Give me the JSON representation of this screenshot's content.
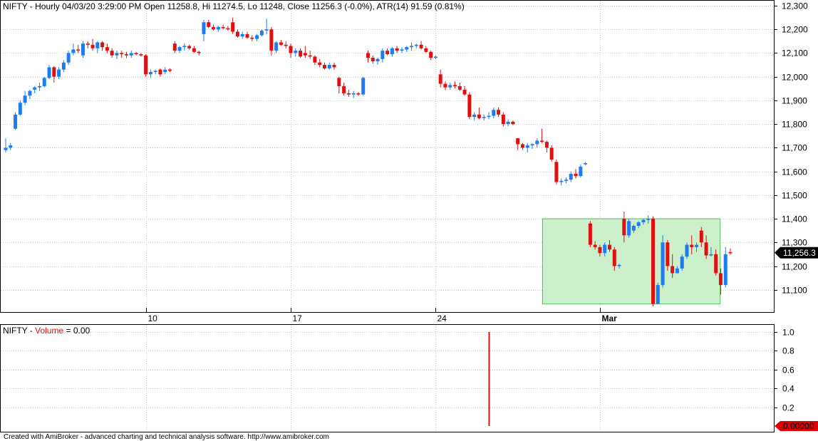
{
  "header": {
    "symbol": "NIFTY",
    "info": " - Hourly 04/03/20 3:29:00 PM Open 11258.8, Hi 11274.5, Lo 11248, Close 11256.3 (-0.0%), ATR(14) 91.59  (0.81%)"
  },
  "volume_header": {
    "symbol": "NIFTY",
    "dash": " - ",
    "label": "Volume",
    "value": " = 0.00"
  },
  "price_tag": "11,256.3",
  "volume_tag": "0.00000",
  "footer": "Created with AmiBroker - advanced charting and technical analysis software. http://www.amibroker.com",
  "colors": {
    "up": "#1e7cf0",
    "down": "#e01010",
    "grid": "#c8c8c8",
    "box_fill": "#ccf0cc",
    "box_stroke": "#55bb55",
    "tag": "#e00000"
  },
  "chart_data": {
    "type": "candlestick",
    "price_axis": {
      "ticks": [
        11100,
        11200,
        11300,
        11400,
        11500,
        11600,
        11700,
        11800,
        11900,
        12000,
        12100,
        12200,
        12300
      ],
      "tick_labels": [
        "11,100",
        "11,200",
        "11,300",
        "11,400",
        "11,500",
        "11,600",
        "11,700",
        "11,800",
        "11,900",
        "12,000",
        "12,100",
        "12,200",
        "12,300"
      ],
      "range": [
        11020,
        12310
      ]
    },
    "date_labels": [
      {
        "label": "10",
        "bar": 29
      },
      {
        "label": "17",
        "bar": 59
      },
      {
        "label": "24",
        "bar": 89
      },
      {
        "label": "Mar",
        "bar": 123,
        "bold": true
      }
    ],
    "highlight_box": {
      "bar_start": 112,
      "bar_end": 147,
      "price_low": 11040,
      "price_high": 11400
    },
    "candles": [
      [
        11690,
        11740,
        11680,
        11700
      ],
      [
        11700,
        11720,
        11690,
        11710
      ],
      [
        11780,
        11850,
        11775,
        11840
      ],
      [
        11840,
        11900,
        11835,
        11890
      ],
      [
        11890,
        11940,
        11880,
        11920
      ],
      [
        11920,
        11945,
        11905,
        11940
      ],
      [
        11945,
        11960,
        11930,
        11955
      ],
      [
        11955,
        11975,
        11940,
        11960
      ],
      [
        11960,
        12000,
        11955,
        11995
      ],
      [
        11995,
        12050,
        11990,
        12040
      ],
      [
        12040,
        12045,
        11975,
        12000
      ],
      [
        12000,
        12040,
        11990,
        12030
      ],
      [
        12030,
        12070,
        12020,
        12060
      ],
      [
        12060,
        12110,
        12050,
        12100
      ],
      [
        12100,
        12140,
        12090,
        12115
      ],
      [
        12115,
        12135,
        12100,
        12110
      ],
      [
        12090,
        12150,
        12080,
        12140
      ],
      [
        12140,
        12150,
        12120,
        12135
      ],
      [
        12135,
        12160,
        12110,
        12120
      ],
      [
        12120,
        12150,
        12100,
        12145
      ],
      [
        12145,
        12150,
        12110,
        12125
      ],
      [
        12125,
        12140,
        12100,
        12110
      ],
      [
        12110,
        12120,
        12080,
        12090
      ],
      [
        12090,
        12110,
        12075,
        12100
      ],
      [
        12100,
        12110,
        12080,
        12095
      ],
      [
        12095,
        12105,
        12080,
        12090
      ],
      [
        12090,
        12110,
        12080,
        12100
      ],
      [
        12100,
        12105,
        12090,
        12095
      ],
      [
        12095,
        12100,
        12085,
        12090
      ],
      [
        12090,
        12095,
        12000,
        12010
      ],
      [
        12010,
        12030,
        11995,
        12020
      ],
      [
        12020,
        12030,
        12010,
        12025
      ],
      [
        12030,
        12035,
        12000,
        12010
      ],
      [
        12020,
        12040,
        12010,
        12030
      ],
      [
        12030,
        12035,
        12020,
        12025
      ],
      [
        12140,
        12150,
        12100,
        12110
      ],
      [
        12110,
        12130,
        12100,
        12125
      ],
      [
        12125,
        12140,
        12110,
        12130
      ],
      [
        12130,
        12135,
        12115,
        12120
      ],
      [
        12120,
        12130,
        12100,
        12105
      ],
      [
        12105,
        12110,
        12090,
        12100
      ],
      [
        12180,
        12240,
        12150,
        12230
      ],
      [
        12230,
        12240,
        12205,
        12210
      ],
      [
        12210,
        12220,
        12195,
        12200
      ],
      [
        12200,
        12215,
        12190,
        12210
      ],
      [
        12210,
        12220,
        12200,
        12205
      ],
      [
        12205,
        12215,
        12195,
        12200
      ],
      [
        12230,
        12250,
        12180,
        12190
      ],
      [
        12190,
        12200,
        12165,
        12170
      ],
      [
        12170,
        12190,
        12160,
        12180
      ],
      [
        12180,
        12190,
        12160,
        12165
      ],
      [
        12165,
        12175,
        12150,
        12160
      ],
      [
        12160,
        12180,
        12150,
        12175
      ],
      [
        12175,
        12200,
        12170,
        12195
      ],
      [
        12195,
        12245,
        12180,
        12200
      ],
      [
        12200,
        12210,
        12090,
        12110
      ],
      [
        12110,
        12150,
        12100,
        12145
      ],
      [
        12145,
        12155,
        12130,
        12135
      ],
      [
        12135,
        12150,
        12120,
        12130
      ],
      [
        12130,
        12140,
        12080,
        12100
      ],
      [
        12100,
        12120,
        12085,
        12110
      ],
      [
        12110,
        12120,
        12080,
        12085
      ],
      [
        12100,
        12130,
        12080,
        12090
      ],
      [
        12090,
        12110,
        12075,
        12085
      ],
      [
        12085,
        12090,
        12050,
        12060
      ],
      [
        12060,
        12075,
        12040,
        12050
      ],
      [
        12050,
        12060,
        12030,
        12035
      ],
      [
        12035,
        12060,
        12030,
        12050
      ],
      [
        12050,
        12060,
        12030,
        12040
      ],
      [
        11995,
        12000,
        11930,
        11960
      ],
      [
        11960,
        11975,
        11920,
        11930
      ],
      [
        11930,
        11945,
        11915,
        11925
      ],
      [
        11925,
        11940,
        11910,
        11930
      ],
      [
        11930,
        11935,
        11920,
        11925
      ],
      [
        11925,
        12000,
        11920,
        11995
      ],
      [
        12100,
        12110,
        12060,
        12080
      ],
      [
        12080,
        12090,
        12055,
        12065
      ],
      [
        12065,
        12080,
        12050,
        12075
      ],
      [
        12075,
        12120,
        12060,
        12110
      ],
      [
        12110,
        12120,
        12090,
        12095
      ],
      [
        12095,
        12125,
        12085,
        12120
      ],
      [
        12120,
        12130,
        12100,
        12110
      ],
      [
        12110,
        12125,
        12100,
        12115
      ],
      [
        12115,
        12130,
        12105,
        12125
      ],
      [
        12125,
        12145,
        12110,
        12130
      ],
      [
        12130,
        12140,
        12120,
        12135
      ],
      [
        12135,
        12150,
        12115,
        12120
      ],
      [
        12120,
        12130,
        12100,
        12105
      ],
      [
        12105,
        12110,
        12070,
        12080
      ],
      [
        12080,
        12090,
        12075,
        12085
      ],
      [
        12010,
        12030,
        11955,
        11970
      ],
      [
        11970,
        11980,
        11945,
        11955
      ],
      [
        11955,
        11975,
        11945,
        11965
      ],
      [
        11965,
        11980,
        11950,
        11960
      ],
      [
        11960,
        11975,
        11940,
        11945
      ],
      [
        11945,
        11960,
        11920,
        11925
      ],
      [
        11925,
        11935,
        11820,
        11830
      ],
      [
        11830,
        11850,
        11815,
        11840
      ],
      [
        11840,
        11870,
        11820,
        11825
      ],
      [
        11825,
        11840,
        11815,
        11830
      ],
      [
        11830,
        11850,
        11820,
        11835
      ],
      [
        11835,
        11870,
        11825,
        11860
      ],
      [
        11860,
        11870,
        11830,
        11840
      ],
      [
        11840,
        11850,
        11790,
        11800
      ],
      [
        11800,
        11820,
        11790,
        11810
      ],
      [
        11810,
        11815,
        11795,
        11800
      ],
      [
        11740,
        11740,
        11690,
        11715
      ],
      [
        11715,
        11720,
        11690,
        11700
      ],
      [
        11700,
        11720,
        11680,
        11710
      ],
      [
        11710,
        11720,
        11695,
        11715
      ],
      [
        11715,
        11740,
        11700,
        11730
      ],
      [
        11730,
        11780,
        11720,
        11725
      ],
      [
        11725,
        11730,
        11680,
        11700
      ],
      [
        11700,
        11710,
        11640,
        11650
      ],
      [
        11640,
        11650,
        11545,
        11555
      ],
      [
        11555,
        11570,
        11540,
        11560
      ],
      [
        11560,
        11575,
        11550,
        11565
      ],
      [
        11565,
        11600,
        11555,
        11590
      ],
      [
        11590,
        11610,
        11570,
        11580
      ],
      [
        11580,
        11630,
        11575,
        11620
      ],
      [
        11630,
        11640,
        11625,
        11635
      ],
      [
        11380,
        11390,
        11280,
        11290
      ],
      [
        11290,
        11305,
        11270,
        11280
      ],
      [
        11280,
        11290,
        11240,
        11255
      ],
      [
        11255,
        11300,
        11240,
        11290
      ],
      [
        11290,
        11310,
        11260,
        11270
      ],
      [
        11270,
        11280,
        11180,
        11200
      ],
      [
        11200,
        11210,
        11190,
        11205
      ],
      [
        11400,
        11430,
        11300,
        11330
      ],
      [
        11330,
        11400,
        11320,
        11390
      ],
      [
        11350,
        11375,
        11340,
        11370
      ],
      [
        11370,
        11390,
        11360,
        11385
      ],
      [
        11385,
        11400,
        11375,
        11395
      ],
      [
        11395,
        11415,
        11380,
        11400
      ],
      [
        11400,
        11410,
        11030,
        11040
      ],
      [
        11040,
        11130,
        11040,
        11120
      ],
      [
        11120,
        11330,
        11110,
        11300
      ],
      [
        11300,
        11310,
        11180,
        11200
      ],
      [
        11200,
        11250,
        11150,
        11170
      ],
      [
        11170,
        11200,
        11170,
        11190
      ],
      [
        11190,
        11250,
        11180,
        11240
      ],
      [
        11240,
        11300,
        11230,
        11290
      ],
      [
        11290,
        11330,
        11250,
        11280
      ],
      [
        11280,
        11300,
        11260,
        11290
      ],
      [
        11350,
        11365,
        11280,
        11300
      ],
      [
        11300,
        11330,
        11230,
        11245
      ],
      [
        11245,
        11280,
        11240,
        11250
      ],
      [
        11250,
        11270,
        11160,
        11170
      ],
      [
        11170,
        11190,
        11080,
        11120
      ],
      [
        11120,
        11280,
        11110,
        11250
      ],
      [
        11258.8,
        11274.5,
        11248,
        11256.3
      ]
    ],
    "volume_axis": {
      "ticks": [
        0.2,
        0.4,
        0.6,
        0.8,
        1.0
      ],
      "tick_labels": [
        "0.2",
        "0.4",
        "0.6",
        "0.8",
        "1.0"
      ],
      "range": [
        0,
        1.05
      ]
    },
    "volume_bars": [
      {
        "bar": 100,
        "value": 1.0
      }
    ]
  }
}
